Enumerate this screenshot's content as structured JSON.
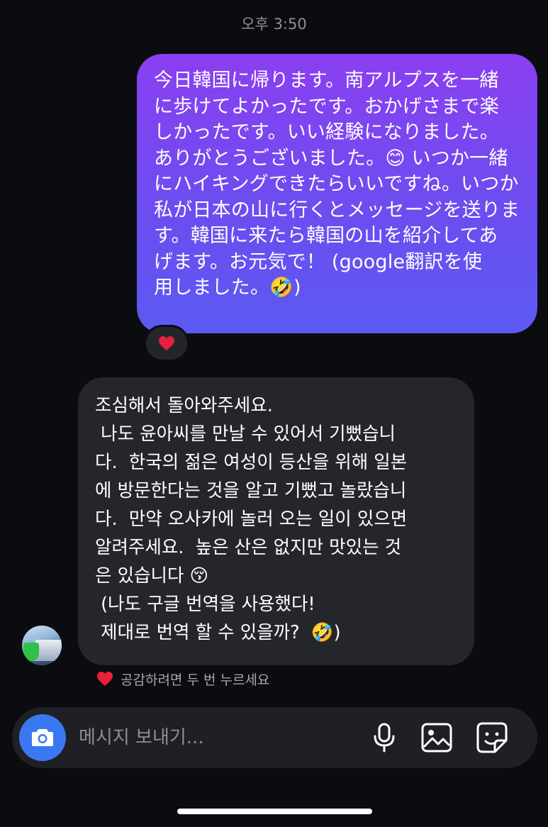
{
  "header": {
    "timestamp": "오후 3:50"
  },
  "messages": {
    "outgoing": {
      "text": "今日韓国に帰ります。南アルプスを一緒\nに歩けてよかったです。おかげさまで楽\nしかったです。いい経験になりました。\nありがとうございました。😊 いつか一緒\nにハイキングできたらいいですね。いつか\n私が日本の山に行くとメッセージを送りま\nす。韓国に来たら韓国の山を紹介してあ\nげます。お元気で！ (google翻訳を使\n用しました。🤣)",
      "reaction": "❤️"
    },
    "incoming": {
      "text": "조심해서 돌아와주세요.\n 나도 윤아씨를 만날 수 있어서 기뻤습니\n다.  한국의 젊은 여성이 등산을 위해 일본\n에 방문한다는 것을 알고 기뻤고 놀랐습니\n다.  만약 오사카에 놀러 오는 일이 있으면\n알려주세요.  높은 산은 없지만 맛있는 것\n은 있습니다 😚\n (나도 구글 번역을 사용했다!\n 제대로 번역 할 수 있을까?  🤣)",
      "hint": "공감하려면 두 번 누르세요"
    }
  },
  "composer": {
    "placeholder": "메시지 보내기..."
  },
  "colors": {
    "outgoing_gradient_top": "#8a3ff0",
    "outgoing_gradient_bottom": "#5b5af2",
    "incoming_bubble": "#25262b",
    "camera_button": "#3a78f2",
    "heart": "#e8203a"
  },
  "icons": {
    "camera": "camera-icon",
    "mic": "microphone-icon",
    "gallery": "image-gallery-icon",
    "sticker": "sticker-icon",
    "heart": "heart-icon"
  }
}
